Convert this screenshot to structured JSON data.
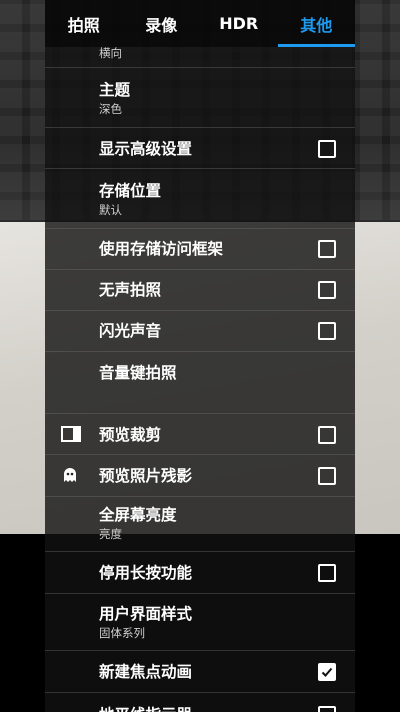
{
  "tabs": [
    {
      "label": "拍照",
      "active": false
    },
    {
      "label": "录像",
      "active": false
    },
    {
      "label": "HDR",
      "active": false
    },
    {
      "label": "其他",
      "active": true
    }
  ],
  "accent_color": "#1e9bf0",
  "settings": {
    "orientation_sub": "横向",
    "theme": {
      "title": "主题",
      "value": "深色"
    },
    "advanced": {
      "title": "显示高级设置",
      "checked": false
    },
    "storage": {
      "title": "存储位置",
      "value": "默认"
    },
    "saf": {
      "title": "使用存储访问框架",
      "checked": false
    },
    "silent": {
      "title": "无声拍照",
      "checked": false
    },
    "flash_sound": {
      "title": "闪光声音",
      "checked": false
    },
    "volume_key": {
      "title": "音量键拍照"
    },
    "crop": {
      "title": "预览裁剪",
      "checked": false,
      "icon": "crop-frame-icon"
    },
    "ghost": {
      "title": "预览照片残影",
      "checked": false,
      "icon": "ghost-icon"
    },
    "brightness": {
      "title": "全屏幕亮度",
      "value": "亮度"
    },
    "long_press": {
      "title": "停用长按功能",
      "checked": false
    },
    "ui_style": {
      "title": "用户界面样式",
      "value": "固体系列"
    },
    "focus_anim": {
      "title": "新建焦点动画",
      "checked": true
    },
    "last_row_partial": {
      "title": "地平线指示器"
    }
  }
}
